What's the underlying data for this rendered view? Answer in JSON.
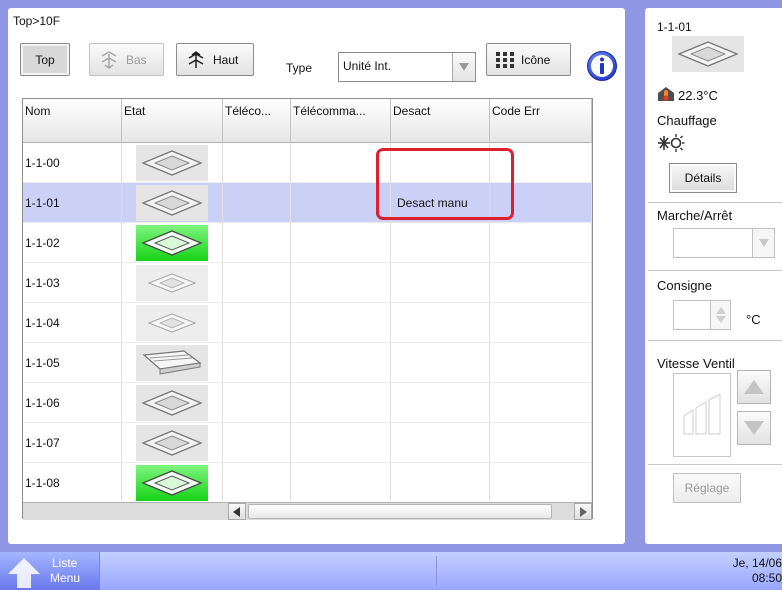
{
  "breadcrumb": "Top>10F",
  "toolbar": {
    "top_label": "Top",
    "bas_label": "Bas",
    "haut_label": "Haut",
    "type_label": "Type",
    "type_value": "Unité Int.",
    "icone_label": "Icône"
  },
  "grid": {
    "columns": [
      "Nom",
      "Etat",
      "Téléco...",
      "Télécomma...",
      "Desact",
      "Code Err"
    ],
    "rows": [
      {
        "nom": "1-1-00",
        "etat": "normal",
        "desact": ""
      },
      {
        "nom": "1-1-01",
        "etat": "normal",
        "desact": "Desact manu"
      },
      {
        "nom": "1-1-02",
        "etat": "green",
        "desact": ""
      },
      {
        "nom": "1-1-03",
        "etat": "light",
        "desact": ""
      },
      {
        "nom": "1-1-04",
        "etat": "light",
        "desact": ""
      },
      {
        "nom": "1-1-05",
        "etat": "wall",
        "desact": ""
      },
      {
        "nom": "1-1-06",
        "etat": "normal",
        "desact": ""
      },
      {
        "nom": "1-1-07",
        "etat": "normal",
        "desact": ""
      },
      {
        "nom": "1-1-08",
        "etat": "green",
        "desact": ""
      }
    ],
    "selected_row": 1
  },
  "right_panel": {
    "unit_name": "1-1-01",
    "temperature": "22.3°C",
    "mode": "Chauffage",
    "details_label": "Détails",
    "onoff_label": "Marche/Arrêt",
    "setpoint_label": "Consigne",
    "setpoint_unit": "°C",
    "fan_label": "Vitesse Ventil",
    "reglage_label": "Réglage"
  },
  "bottom_bar": {
    "menu_line1": "Liste",
    "menu_line2": "Menu",
    "date": "Je, 14/06",
    "time": "08:50"
  },
  "colors": {
    "background": "#8f96e4",
    "selected_row": "#cbd1f6",
    "highlight": "#df1f30",
    "status_green": "#16d316"
  }
}
